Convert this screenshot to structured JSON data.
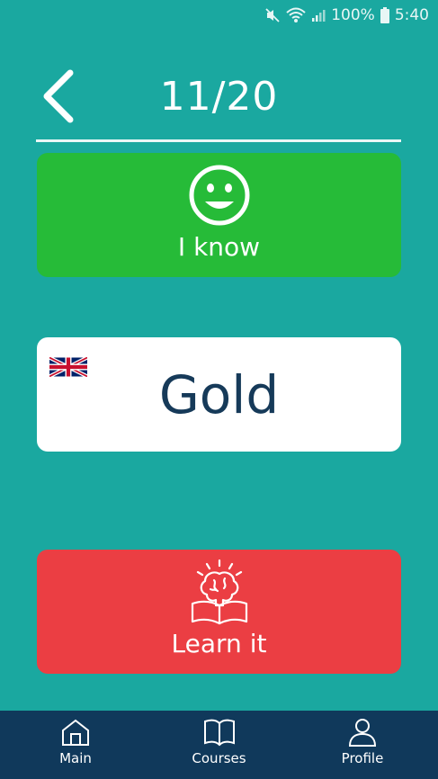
{
  "status": {
    "battery_percent": "100%",
    "time": "5:40"
  },
  "header": {
    "progress": "11/20"
  },
  "know_card": {
    "label": "I know"
  },
  "word_card": {
    "word": "Gold",
    "flag_icon": "uk-flag-icon"
  },
  "learn_card": {
    "label": "Learn it"
  },
  "nav": {
    "items": [
      {
        "label": "Main",
        "icon": "home-icon"
      },
      {
        "label": "Courses",
        "icon": "book-icon"
      },
      {
        "label": "Profile",
        "icon": "user-icon"
      }
    ]
  },
  "colors": {
    "background": "#1aa8a0",
    "know": "#26bb38",
    "learn": "#eb3e43",
    "word_text": "#163a59",
    "nav": "#10395b"
  }
}
